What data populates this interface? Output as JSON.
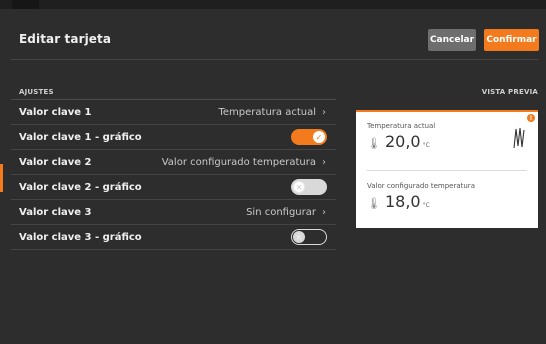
{
  "header": {
    "title": "Editar tarjeta",
    "cancel_label": "Cancelar",
    "confirm_label": "Confirmar"
  },
  "sections": {
    "settings_label": "AJUSTES",
    "preview_label": "VISTA PREVIA"
  },
  "rows": [
    {
      "label": "Valor clave 1",
      "value": "Temperatura actual",
      "type": "select"
    },
    {
      "label": "Valor clave 1 - gráfico",
      "type": "toggle",
      "state": "on"
    },
    {
      "label": "Valor clave 2",
      "value": "Valor configurado temperatura",
      "type": "select"
    },
    {
      "label": "Valor clave 2 - gráfico",
      "type": "toggle",
      "state": "off"
    },
    {
      "label": "Valor clave 3",
      "value": "Sin configurar",
      "type": "select"
    },
    {
      "label": "Valor clave 3 - gráfico",
      "type": "toggle",
      "state": "disabled"
    }
  ],
  "preview": {
    "item1_label": "Temperatura actual",
    "item1_value": "20,0",
    "item1_unit": "°C",
    "item2_label": "Valor configurado temperatura",
    "item2_value": "18,0",
    "item2_unit": "°C",
    "badge": "!"
  },
  "icons": {
    "chevron": "chevron-right-icon",
    "check": "check-icon",
    "close": "close-icon",
    "thermometer": "thermometer-icon",
    "alert": "alert-icon",
    "sparkline": "sparkline-icon"
  },
  "colors": {
    "accent": "#f37b1d",
    "background": "#2d2d2d",
    "card": "#ffffff"
  }
}
